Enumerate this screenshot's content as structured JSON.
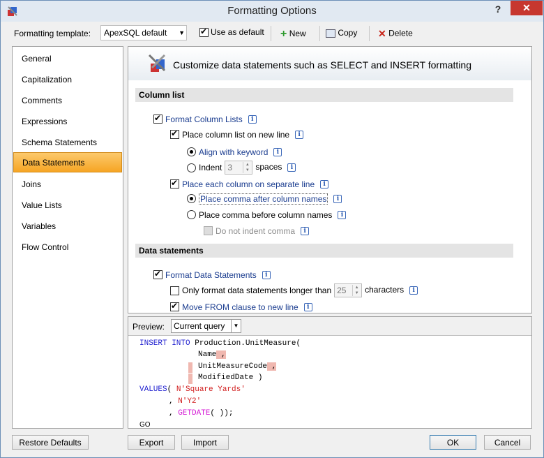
{
  "window": {
    "title": "Formatting Options",
    "help": "?",
    "close": "✕"
  },
  "toolbar": {
    "template_label": "Formatting template:",
    "template_value": "ApexSQL default",
    "use_as_default": "Use as default",
    "new_label": "New",
    "copy_label": "Copy",
    "delete_label": "Delete"
  },
  "sidebar": {
    "items": [
      {
        "label": "General"
      },
      {
        "label": "Capitalization"
      },
      {
        "label": "Comments"
      },
      {
        "label": "Expressions"
      },
      {
        "label": "Schema Statements"
      },
      {
        "label": "Data Statements"
      },
      {
        "label": "Joins"
      },
      {
        "label": "Value Lists"
      },
      {
        "label": "Variables"
      },
      {
        "label": "Flow Control"
      }
    ],
    "active": "Data Statements"
  },
  "content": {
    "banner": "Customize data statements such as SELECT and INSERT formatting",
    "column_list": {
      "heading": "Column list",
      "format_column_lists": "Format Column Lists",
      "place_on_new_line": "Place column list on new line",
      "align_with_keyword": "Align with keyword",
      "indent": "Indent",
      "indent_value": "3",
      "spaces": "spaces",
      "separate_line": "Place each column on separate line",
      "comma_after": "Place comma after column names",
      "comma_before": "Place comma before column names",
      "no_indent_comma": "Do not indent comma"
    },
    "data_statements": {
      "heading": "Data statements",
      "format_data": "Format Data Statements",
      "only_longer": "Only format data statements longer than",
      "longer_value": "25",
      "characters": "characters",
      "move_from": "Move FROM clause to new line"
    }
  },
  "preview": {
    "label": "Preview:",
    "select_value": "Current query",
    "code": {
      "l1_kw": "INSERT INTO",
      "l1_rest": "Production.UnitMeasure(",
      "l2": "Name",
      "l2c": " ,",
      "l3": "UnitMeasureCode",
      "l3c": " ,",
      "l4": "ModifiedDate )",
      "l5_kw": "VALUES",
      "l5_p": "( ",
      "l5_s": "N'Square Yards'",
      "l6_p": ", ",
      "l6_s": "N'Y2'",
      "l7_p": ", ",
      "l7_f": "GETDATE",
      "l7_rest": "( ));",
      "l8": "GO"
    }
  },
  "buttons": {
    "restore": "Restore Defaults",
    "export": "Export",
    "import": "Import",
    "ok": "OK",
    "cancel": "Cancel"
  }
}
